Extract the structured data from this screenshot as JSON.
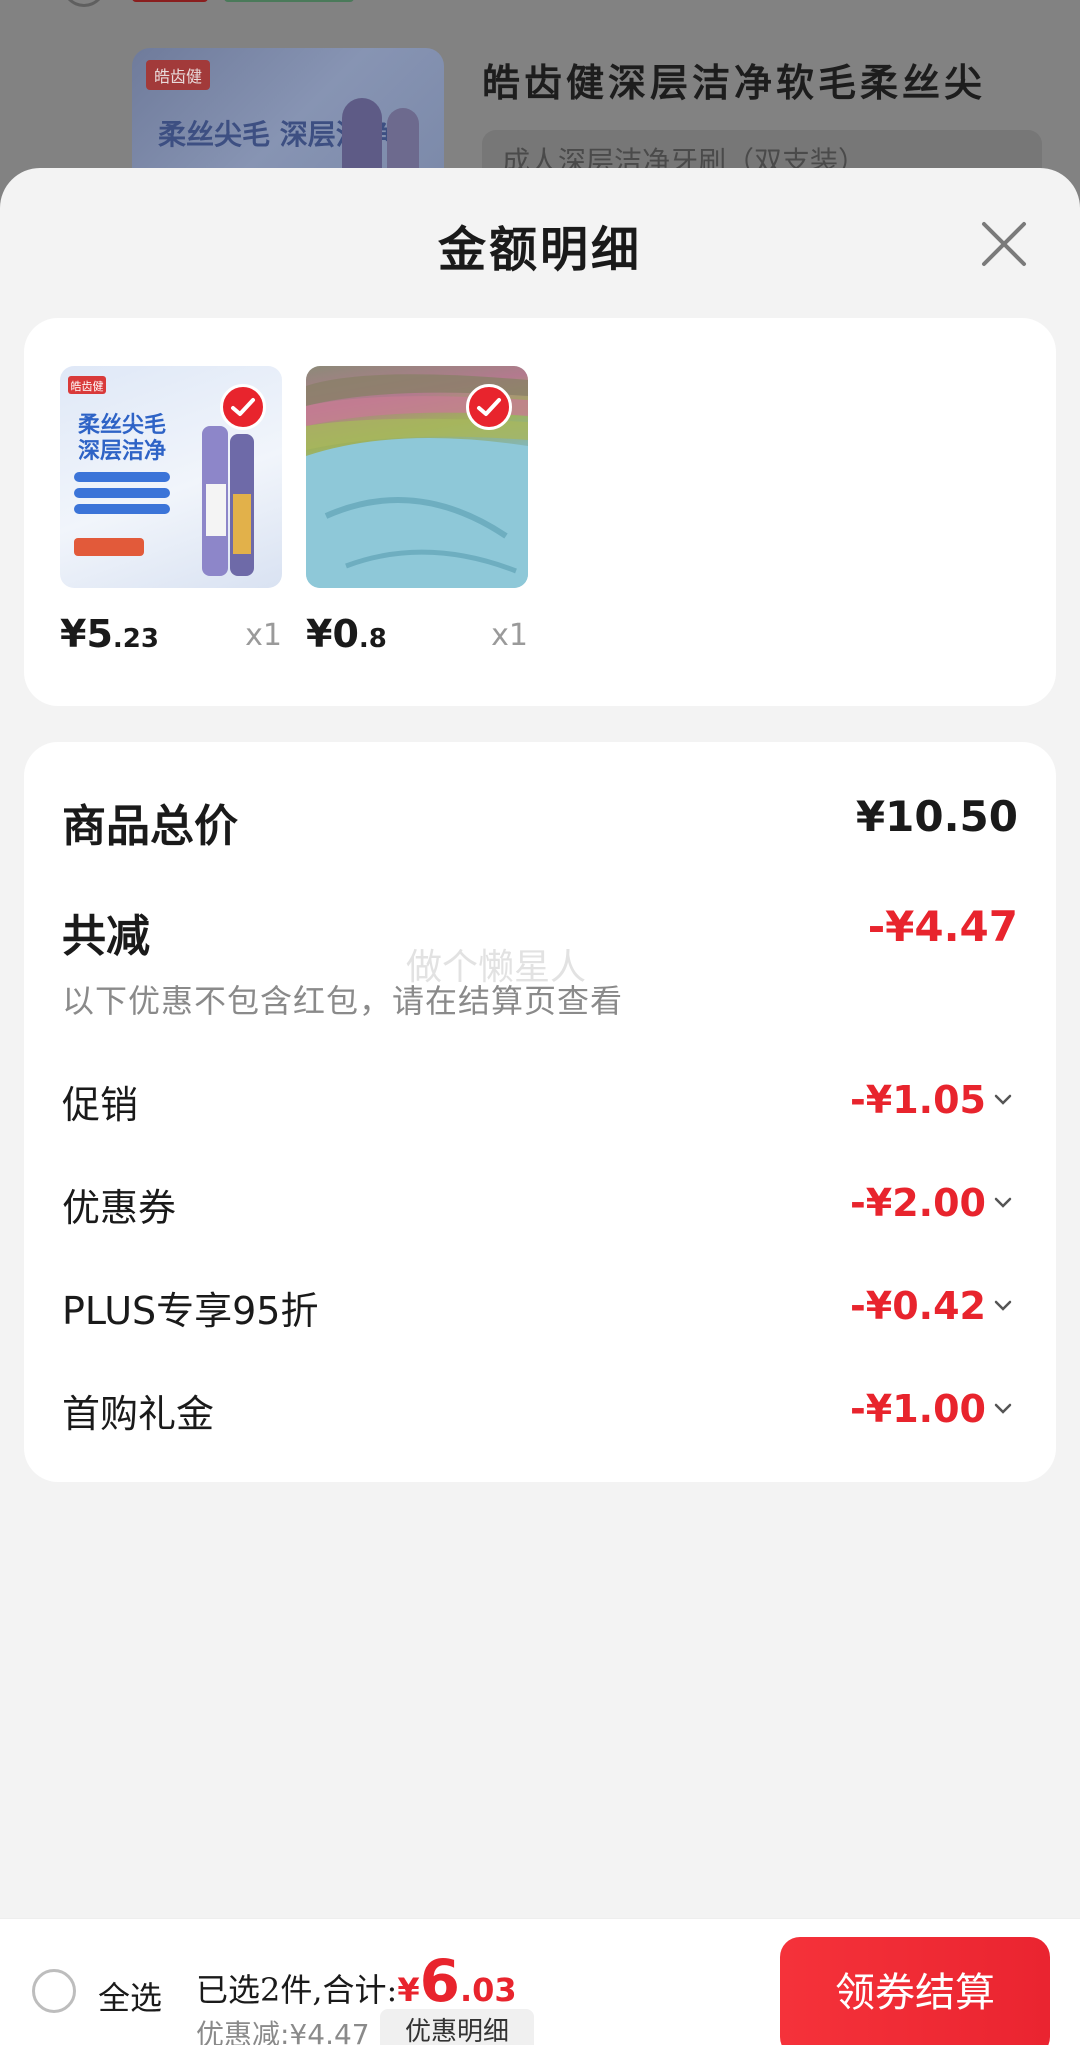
{
  "background": {
    "brand_logo": "皓齿健",
    "product_title": "皓齿健深层洁净软毛柔丝尖",
    "spec_text": "成人深层洁净牙刷（双支装）",
    "slogan": "柔丝尖毛 深层洁净"
  },
  "sheet": {
    "title": "金额明细",
    "close_icon": "close-icon"
  },
  "goods": [
    {
      "name": "toothbrush",
      "price_symbol": "¥",
      "price_int": "5",
      "price_dec": ".23",
      "qty": "x1",
      "checked": true
    },
    {
      "name": "towel",
      "price_symbol": "¥",
      "price_int": "0",
      "price_dec": ".8",
      "qty": "x1",
      "checked": true
    }
  ],
  "price": {
    "total_label": "商品总价",
    "total_value": "¥10.50",
    "reduce_label": "共减",
    "reduce_value": "-¥4.47",
    "note": "以下优惠不包含红包，请在结算页查看",
    "watermark": "做个懒星人",
    "discounts": [
      {
        "label": "促销",
        "value": "-¥1.05"
      },
      {
        "label": "优惠券",
        "value": "-¥2.00"
      },
      {
        "label": "PLUS专享95折",
        "value": "-¥0.42"
      },
      {
        "label": "首购礼金",
        "value": "-¥1.00"
      }
    ]
  },
  "bottom": {
    "select_all": "全选",
    "summary": "已选2件,合计:",
    "total_symbol": "¥",
    "total_int": "6",
    "total_dec": ".03",
    "discount": "优惠减:¥4.47",
    "detail_btn": "优惠明细",
    "checkout_btn": "领券结算"
  },
  "colors": {
    "accent": "#e8242d",
    "sheet_bg": "#f3f3f3",
    "card_bg": "#ffffff"
  }
}
